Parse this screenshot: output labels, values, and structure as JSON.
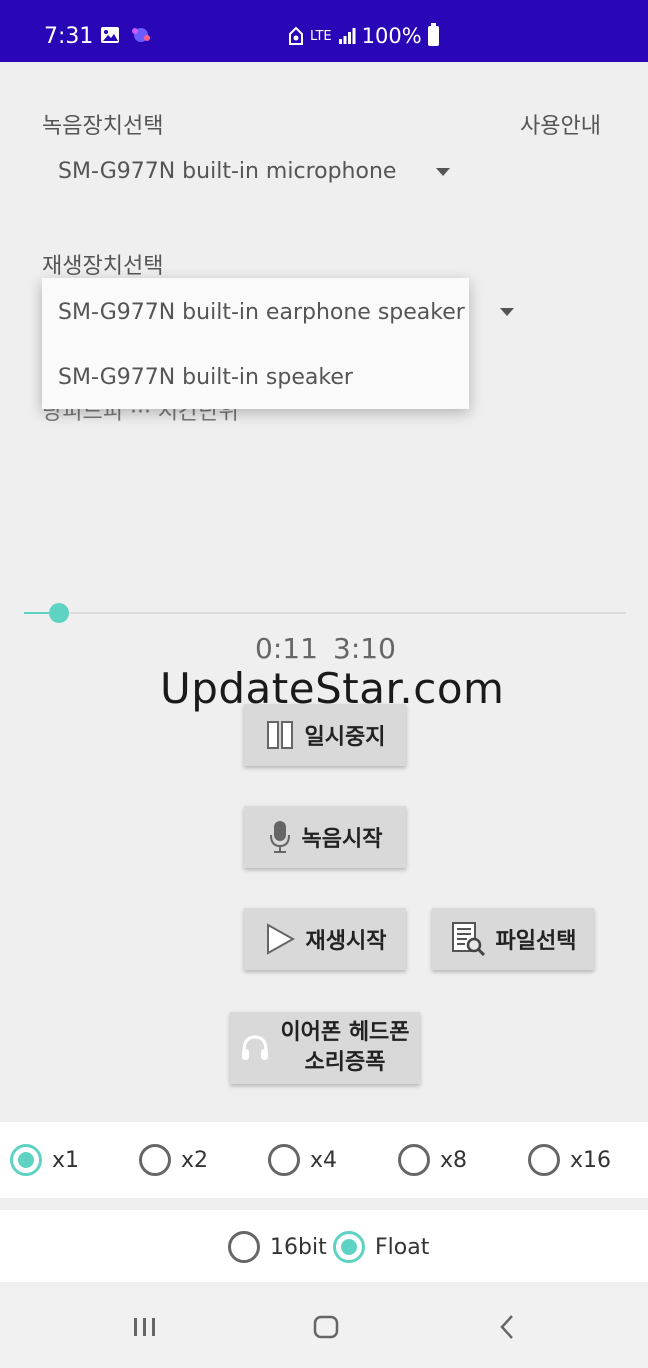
{
  "status_bar": {
    "time": "7:31",
    "network": "LTE",
    "battery": "100%"
  },
  "record_device": {
    "label": "녹음장치선택",
    "value": "SM-G977N built-in microphone"
  },
  "help_label": "사용안내",
  "playback_device": {
    "label": "재생장치선택",
    "options": [
      "SM-G977N built-in earphone speaker",
      "SM-G977N built-in speaker"
    ]
  },
  "obscured_text": "당피드피 ··· 시간단위",
  "player": {
    "progress": 0.058,
    "elapsed": "0:11",
    "duration": "3:10"
  },
  "watermark": "UpdateStar.com",
  "buttons": {
    "pause": "일시중지",
    "record": "녹음시작",
    "play": "재생시작",
    "file": "파일선택",
    "amplify_line1": "이어폰 헤드폰",
    "amplify_line2": "소리증폭"
  },
  "multiplier": {
    "options": [
      "x1",
      "x2",
      "x4",
      "x8",
      "x16"
    ],
    "selected": "x1"
  },
  "format": {
    "options": [
      "16bit",
      "Float"
    ],
    "selected": "Float"
  },
  "colors": {
    "status_bar": "#2a07b6",
    "accent": "#5fd3c3"
  }
}
